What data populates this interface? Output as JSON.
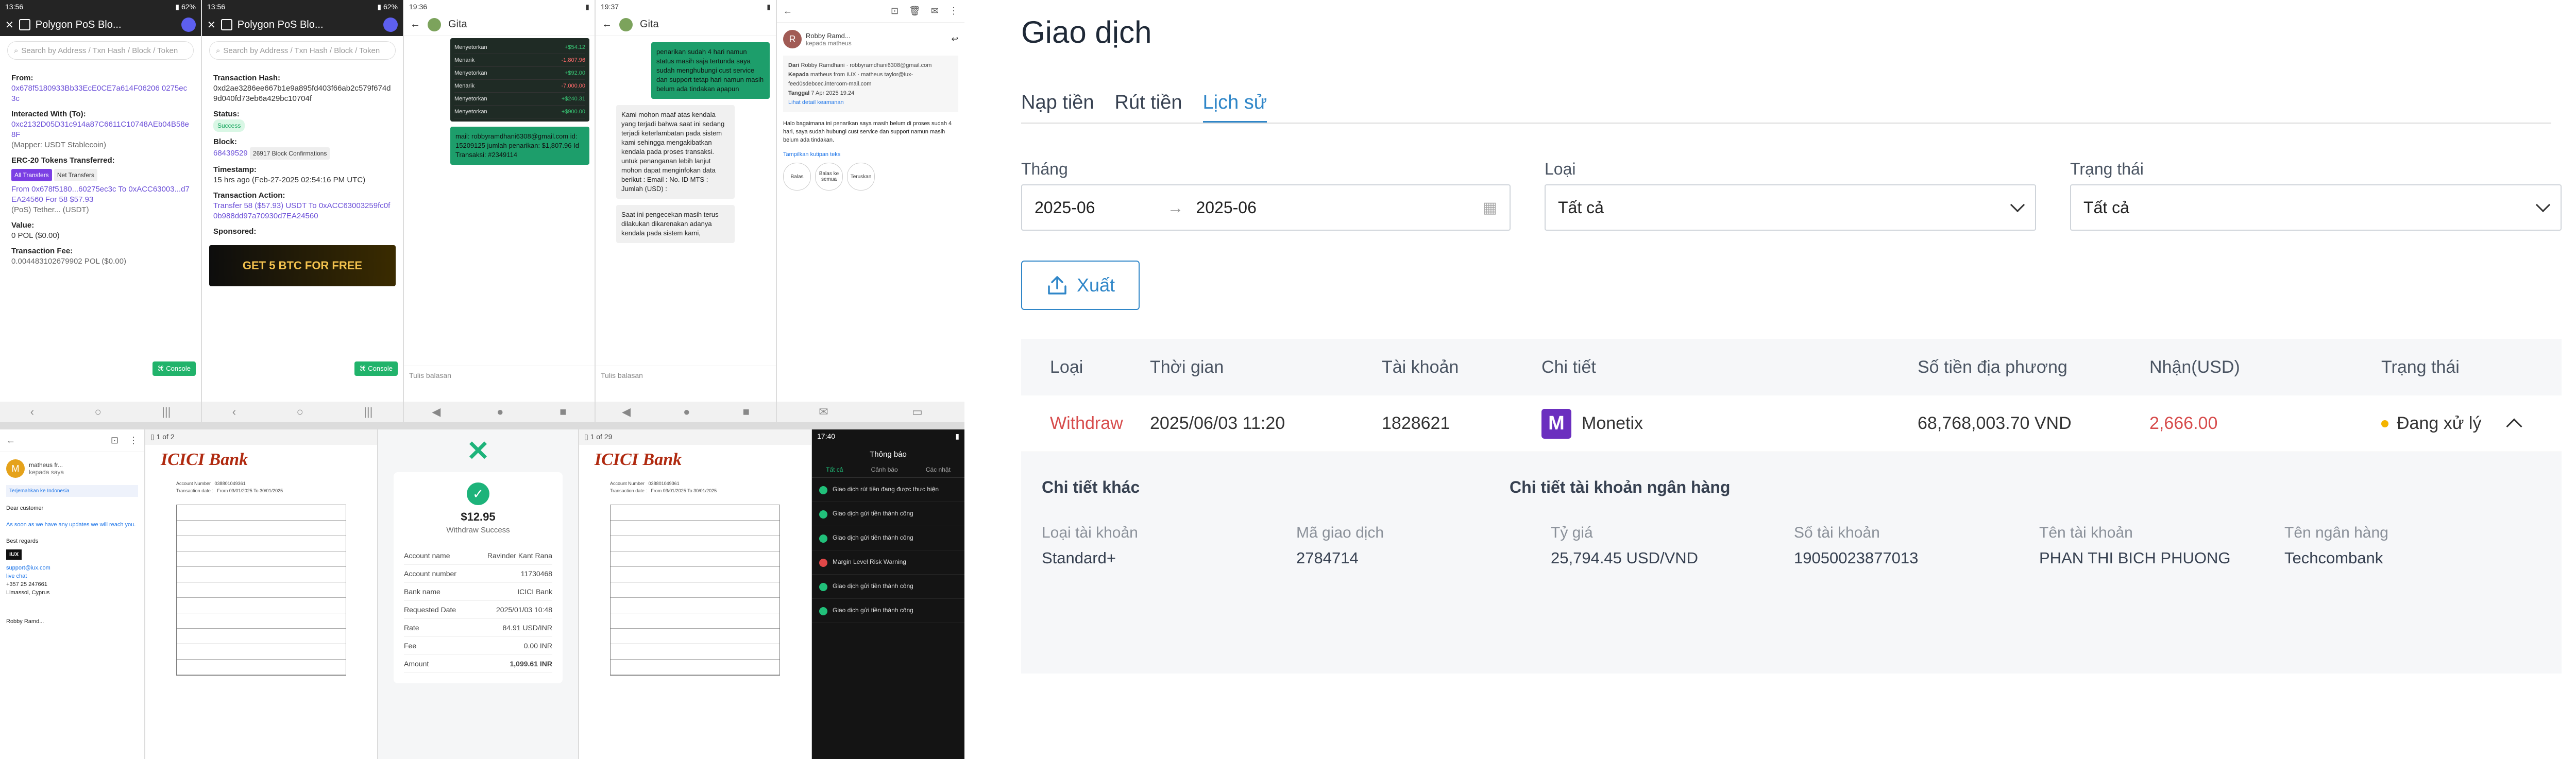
{
  "collage": {
    "poly_left": {
      "status_time": "13:56",
      "app_title": "Polygon PoS Blo...",
      "search_placeholder": "Search by Address / Txn Hash / Block / Token",
      "from_label": "From:",
      "from_value": "0x678f5180933Bb33EcE0CE7a614F06206 0275ec3c",
      "to_label": "Interacted With (To):",
      "to_value": "0xc2132D05D31c914a87C6611C10748AEb04B58e8F",
      "to_note": "(Mapper: USDT Stablecoin)",
      "erc_label": "ERC-20 Tokens Transferred:",
      "tab_all": "All Transfers",
      "tab_net": "Net Transfers",
      "transfer_line": "From 0x678f5180...60275ec3c To 0xACC63003...d7EA24560 For 58 $57.93",
      "transfer_token": "(PoS) Tether... (USDT)",
      "value_label": "Value:",
      "value": "0 POL ($0.00)",
      "fee_label": "Transaction Fee:",
      "fee_value": "0.004483102679902 POL ($0.00)",
      "chip": "Console"
    },
    "poly_right": {
      "status_time": "13:56",
      "app_title": "Polygon PoS Blo...",
      "search_placeholder": "Search by Address / Txn Hash / Block / Token",
      "hash_label": "Transaction Hash:",
      "hash_value": "0xd2ae3286ee667b1e9a895fd403f66ab2c579f674d9d040fd73eb6a429bc10704f",
      "status_label": "Status:",
      "status_value": "Success",
      "block_label": "Block:",
      "block_value": "68439529",
      "block_conf": "26917 Block Confirmations",
      "ts_label": "Timestamp:",
      "ts_value": "15 hrs ago (Feb-27-2025 02:54:16 PM UTC)",
      "action_label": "Transaction Action:",
      "action_value": "Transfer 58 ($57.93) USDT To 0xACC63003259fc0f0b988dd97a70930d7EA24560",
      "sponsored": "Sponsored:",
      "ad_text": "GET 5 BTC FOR FREE",
      "chip": "Console"
    },
    "chat_left": {
      "status_time": "19:36",
      "contact": "Gita",
      "rows": [
        {
          "label": "Menyetorkan",
          "amount": "+$54.12"
        },
        {
          "label": "Menarik",
          "amount": "-1,807.96"
        },
        {
          "label": "Menyetorkan",
          "amount": "+$92.00"
        },
        {
          "label": "Menarik",
          "amount": "-7,000.00"
        },
        {
          "label": "Menyetorkan",
          "amount": "+$240.31"
        },
        {
          "label": "Menyetorkan",
          "amount": "+$900.00"
        }
      ],
      "green_text": "mail: robbyramdhani6308@gmail.com id: 15209125 jumlah penarikan: $1,807.96 Id Transaksi: #2349114",
      "compose_placeholder": "Tulis balasan"
    },
    "chat_right": {
      "status_time": "19:37",
      "contact": "Gita",
      "green_text": "penarikan sudah 4 hari namun status masih saja tertunda saya sudah menghubungi cust service dan support tetap hari namun masih belum ada tindakan apapun",
      "white_text": "Kami mohon maaf atas kendala yang terjadi bahwa saat ini sedang terjadi keterlambatan pada sistem kami sehingga mengakibatkan kendala pada proses transaksi. untuk penanganan lebih lanjut mohon dapat menginfokan data berikut : Email : No. ID MTS : Jumlah (USD) :",
      "white_text2": "Saat ini pengecekan masih terus dilakukan dikarenakan adanya kendala pada sistem kami,",
      "compose_placeholder": "Tulis balasan"
    },
    "mail_right": {
      "sender": "Robby Ramd...",
      "to_line": "kepada matheus",
      "dari_label": "Dari",
      "dari_value": "Robby Ramdhani · robbyramdhani6308@gmail.com",
      "kepada_label": "Kepada",
      "kepada_value": "matheus from IUX · matheus taylor@iux-feed0sdebcec.intercom-mail.com",
      "tanggal_label": "Tanggal",
      "tanggal_value": "7 Apr 2025 19.24",
      "detail_link": "Lihat detail keamanan",
      "body": "Halo bagaimana ini penarikan saya masih belum di proses sudah 4 hari, saya sudah hubungi cust service dan support namun masih belum ada tindakan.",
      "quoted": "Tampilkan kutipan teks",
      "btn_reply": "Balas",
      "btn_reply_all": "Balas ke semua",
      "btn_forward": "Teruskan"
    },
    "mail_left": {
      "sender": "matheus fr...",
      "to_line": "kepada saya",
      "translate": "Terjemahkan ke Indonesia",
      "greet": "Dear customer",
      "body": "As soon as we have any updates we will reach you.",
      "sign": "Best regards",
      "brand": "iUX",
      "site": "support@iux.com",
      "chat": "live chat",
      "phone": "+357 25 247661",
      "city": "Limassol, Cyprus",
      "footer_sender": "Robby Ramd..."
    },
    "pdf_left": {
      "pages": "1 of 2",
      "bank": "ICICI Bank",
      "acct_label": "Account Number",
      "acct_value": "038801049361",
      "date_label": "Transaction date :",
      "date_value": "From 03/01/2025 To 30/01/2025"
    },
    "receipt": {
      "amount": "$12.95",
      "status": "Withdraw Success",
      "rows": [
        {
          "k": "Account name",
          "v": "Ravinder Kant Rana"
        },
        {
          "k": "Account number",
          "v": "11730468"
        },
        {
          "k": "Bank name",
          "v": "ICICI Bank"
        },
        {
          "k": "Requested Date",
          "v": "2025/01/03 10:48"
        },
        {
          "k": "Rate",
          "v": "84.91 USD/INR"
        },
        {
          "k": "Fee",
          "v": "0.00 INR"
        },
        {
          "k": "Amount",
          "v": "1,099.61 INR"
        }
      ]
    },
    "pdf_right": {
      "pages": "1 of 29",
      "bank": "ICICI Bank",
      "acct_label": "Account Number",
      "acct_value": "038801049361",
      "date_label": "Transaction date :",
      "date_value": "From 03/01/2025 To 30/01/2025"
    },
    "notif": {
      "status_time": "17:40",
      "title": "Thông báo",
      "tab_all": "Tất cả",
      "tab_warn": "Cảnh báo",
      "tab_other": "Các nhật",
      "items": [
        {
          "title": "Giao dịch rút tiền đang được thực hiện",
          "kind": "ok"
        },
        {
          "title": "Giao dịch gửi tiền thành công",
          "kind": "ok"
        },
        {
          "title": "Giao dịch gửi tiền thành công",
          "kind": "ok"
        },
        {
          "title": "Margin Level Risk Warning",
          "kind": "warn"
        },
        {
          "title": "Giao dịch gửi tiền thành công",
          "kind": "ok"
        },
        {
          "title": "Giao dịch gửi tiền thành công",
          "kind": "ok"
        }
      ]
    }
  },
  "transactions": {
    "page_title": "Giao dịch",
    "tabs": [
      {
        "label": "Nạp tiền",
        "active": false
      },
      {
        "label": "Rút tiền",
        "active": false
      },
      {
        "label": "Lịch sử",
        "active": true
      }
    ],
    "filters": {
      "month_label": "Tháng",
      "month_from": "2025-06",
      "month_to": "2025-06",
      "type_label": "Loại",
      "type_value": "Tất cả",
      "status_label": "Trạng thái",
      "status_value": "Tất cả"
    },
    "export_label": "Xuất",
    "columns": [
      "Loại",
      "Thời gian",
      "Tài khoản",
      "Chi tiết",
      "Số tiền địa phương",
      "Nhận(USD)",
      "Trạng thái"
    ],
    "row": {
      "type": "Withdraw",
      "time": "2025/06/03 11:20",
      "account": "1828621",
      "detail": "Monetix",
      "detail_logo": "M",
      "local_amount": "68,768,003.70 VND",
      "receive_usd": "2,666.00",
      "status": "Đang xử lý"
    },
    "detail": {
      "other_title": "Chi tiết khác",
      "bank_title": "Chi tiết tài khoản ngân hàng",
      "acct_type_label": "Loại tài khoản",
      "acct_type_value": "Standard+",
      "txn_id_label": "Mã giao dịch",
      "txn_id_value": "2784714",
      "rate_label": "Tỷ giá",
      "rate_value": "25,794.45 USD/VND",
      "bank_acct_label": "Số tài khoản",
      "bank_acct_value": "19050023877013",
      "holder_label": "Tên tài khoản",
      "holder_value": "PHAN THI BICH PHUONG",
      "bank_name_label": "Tên ngân hàng",
      "bank_name_value": "Techcombank"
    },
    "colors": {
      "accent": "#2f86c8",
      "withdraw": "#d74c4c",
      "pending": "#f4b400",
      "monetix": "#6b2fbf"
    }
  }
}
